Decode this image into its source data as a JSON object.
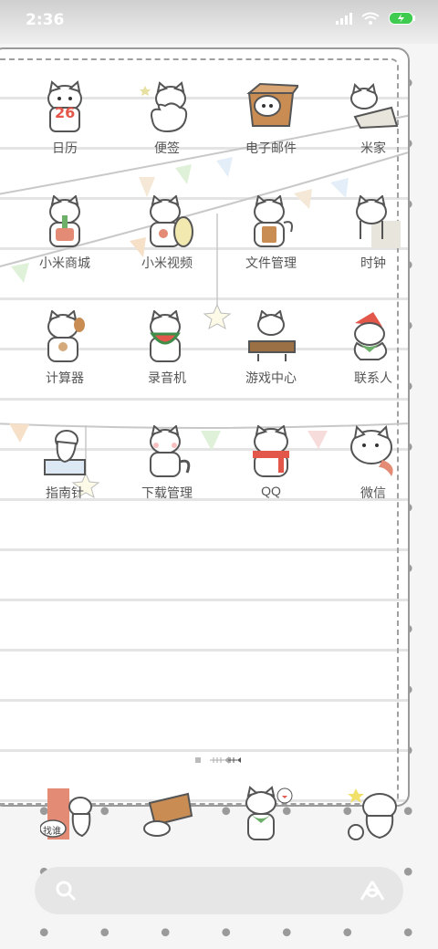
{
  "status": {
    "time": "2:36"
  },
  "apps": [
    {
      "label": "日历",
      "badge": "26"
    },
    {
      "label": "便签"
    },
    {
      "label": "电子邮件"
    },
    {
      "label": "米家"
    },
    {
      "label": "小米商城"
    },
    {
      "label": "小米视频"
    },
    {
      "label": "文件管理"
    },
    {
      "label": "时钟"
    },
    {
      "label": "计算器"
    },
    {
      "label": "录音机"
    },
    {
      "label": "游戏中心"
    },
    {
      "label": "联系人"
    },
    {
      "label": "指南针"
    },
    {
      "label": "下载管理"
    },
    {
      "label": "QQ"
    },
    {
      "label": "微信"
    }
  ],
  "dock": {
    "bubble_text": "找谁"
  },
  "colors": {
    "accent": "#e38b75",
    "battery": "#3ecb4f"
  }
}
